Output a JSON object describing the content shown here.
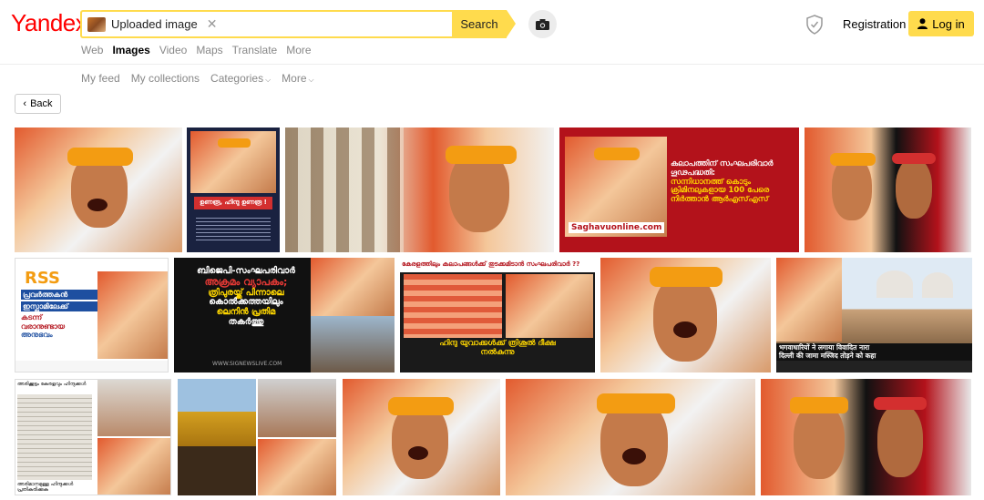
{
  "header": {
    "logo": "Yandex",
    "search_chip": "Uploaded image",
    "search_button": "Search",
    "registration": "Registration",
    "login": "Log in"
  },
  "services": [
    "Web",
    "Images",
    "Video",
    "Maps",
    "Translate",
    "More"
  ],
  "subnav": [
    "My feed",
    "My collections",
    "Categories",
    "More"
  ],
  "back": "Back",
  "tile_texts": {
    "t2_title": "ഉണരൂ, ഹിന്ദു ഉണരൂ !",
    "t4_line1": "കലാപത്തിന് സംഘപരിവാർ",
    "t4_line2": "ഗൂഢപദ്ധതി:",
    "t4_line3": "സന്നിധാനത്ത് കൊടും",
    "t4_line4": "ക്രിമിനലുകളായ 100 പേരെ",
    "t4_line5": "നിർത്താൻ ആർഎസ്എസ്",
    "t4_brand": "Saghavuonline.com",
    "t6_rss": "RSS",
    "t6_line1": "പ്രവർത്തകൻ",
    "t6_line2": "ഇസ്ലാമിലേക്ക്",
    "t6_line3": "കടന്ന്",
    "t6_line4": "വരാനുണ്ടായ",
    "t6_line5": "അനുഭവം",
    "t7_line1": "ബിജെപി-സംഘപരിവാർ",
    "t7_line2": "അക്രമം വ്യാപകം;",
    "t7_line3": "ത്രിപുരയ്ക്ക് പിന്നാലെ",
    "t7_line4": "കൊൽക്കത്തയിലും",
    "t7_line5": "ലെനിൻ പ്രതിമ",
    "t7_line6": "തകർത്തു",
    "t7_url": "WWW.SIGNEWSLIVE.COM",
    "t8_top": "കേരളത്തിലും കലാപങ്ങൾക്ക് തുടക്കമിടാൻ സംഘപരിവാർ ??",
    "t8_bottom1": "ഹിന്ദു യുവാക്കൾക്ക് ത്രിശൂൽ ദീക്ഷ",
    "t8_bottom2": "നൽകുന്നു",
    "t10_line1": "भगवाधारियों ने लगाया विवादित नारा",
    "t10_line2": "दिल्ली की जामा मस्जिद तोड़ने को कहा",
    "t11_top": "അരിക്കൂട്ടം കേരളവും ഹിന്ദുക്കൾ",
    "t11_bottom": "അരിമാനമുള്ള ഹിന്ദുക്കൾ പ്രതികരിക്കുക"
  },
  "colors": {
    "accent": "#ffdb4d",
    "logo_red": "#ff0000",
    "saffron": "#f39c12",
    "dark_red": "#b3121b"
  }
}
